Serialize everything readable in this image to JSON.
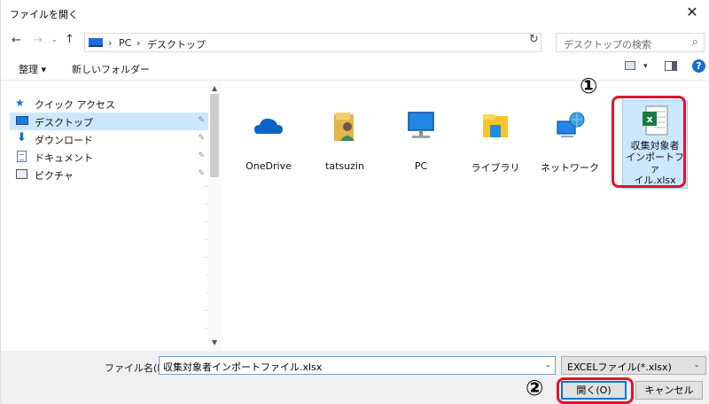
{
  "window": {
    "title": "ファイルを開く",
    "close_glyph": "✕"
  },
  "nav_buttons": {
    "back": "←",
    "forward": "→",
    "recent": "⌄",
    "up": "↑"
  },
  "address": {
    "sep1": "›",
    "crumb1": "PC",
    "sep2": "›",
    "crumb2": "デスクトップ",
    "dropdown": "⌄",
    "refresh": "↻"
  },
  "search": {
    "placeholder": "デスクトップの検索",
    "icon": "⌕"
  },
  "toolbar": {
    "organize_label": "整理 ▾",
    "new_folder_label": "新しいフォルダー",
    "view_dd": "▾",
    "help": "?"
  },
  "sidebar": {
    "items": [
      {
        "label": "クイック アクセス",
        "icon": "star-icon"
      },
      {
        "label": "デスクトップ",
        "icon": "desktop-icon",
        "pinned": true,
        "selected": true
      },
      {
        "label": "ダウンロード",
        "icon": "download-icon",
        "pinned": true
      },
      {
        "label": "ドキュメント",
        "icon": "document-icon",
        "pinned": true
      },
      {
        "label": "ピクチャ",
        "icon": "pictures-icon",
        "pinned": true
      }
    ],
    "pin_glyph": "📌",
    "scroll_up": "▲",
    "scroll_down": "▼"
  },
  "files": [
    {
      "label": "OneDrive",
      "icon": "onedrive-icon"
    },
    {
      "label": "tatsuzin",
      "icon": "user-folder-icon"
    },
    {
      "label": "PC",
      "icon": "pc-icon"
    },
    {
      "label": "ライブラリ",
      "icon": "library-icon"
    },
    {
      "label": "ネットワーク",
      "icon": "network-icon"
    },
    {
      "label_line1": "収集対象者",
      "label_line2": "インポートファ",
      "label_line3": "イル.xlsx",
      "icon": "excel-file-icon",
      "selected": true
    }
  ],
  "footer": {
    "filename_label": "ファイル名(N):",
    "filename_value": "収集対象者インポートファイル.xlsx",
    "filetype_value": "EXCELファイル(*.xlsx)",
    "dropdown": "⌄",
    "open_label": "開く(O)",
    "cancel_label": "キャンセル"
  },
  "annotations": {
    "step1": "①",
    "step2": "②"
  },
  "colors": {
    "accent": "#0078d7",
    "selection": "#cce8ff",
    "annotation_red": "#e0142b"
  }
}
